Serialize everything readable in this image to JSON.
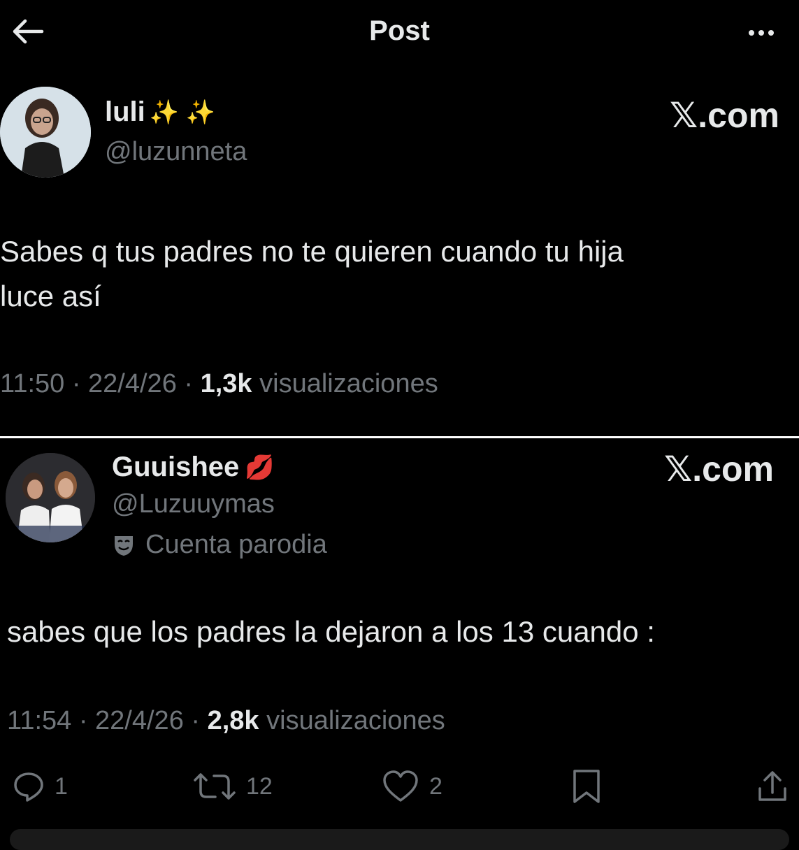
{
  "header": {
    "title": "Post",
    "back_icon": "arrow-left-icon",
    "more_icon": "more-horizontal-icon"
  },
  "posts": [
    {
      "display_name": "luli",
      "name_emoji": "✨ ✨",
      "handle": "@luzunneta",
      "brand": "𝕏.com",
      "text_line1": "Sabes q tus padres no te quieren cuando tu hija",
      "text_line2": "luce así",
      "time": "11:50 · 22/4/26 ·",
      "views": "1,3k",
      "views_label": "visualizaciones"
    },
    {
      "display_name": "Guuishee",
      "name_emoji": "💋",
      "handle": "@Luzuuymas",
      "parody_label": "Cuenta parodia",
      "brand": "𝕏.com",
      "text": "sabes que los padres la dejaron a los 13 cuando :",
      "time": "11:54 · 22/4/26 ·",
      "views": "2,8k",
      "views_label": "visualizaciones",
      "replies": "1",
      "reposts": "12",
      "likes": "2"
    }
  ],
  "colors": {
    "background": "#000000",
    "text": "#e7e9ea",
    "secondary": "#71767b"
  }
}
